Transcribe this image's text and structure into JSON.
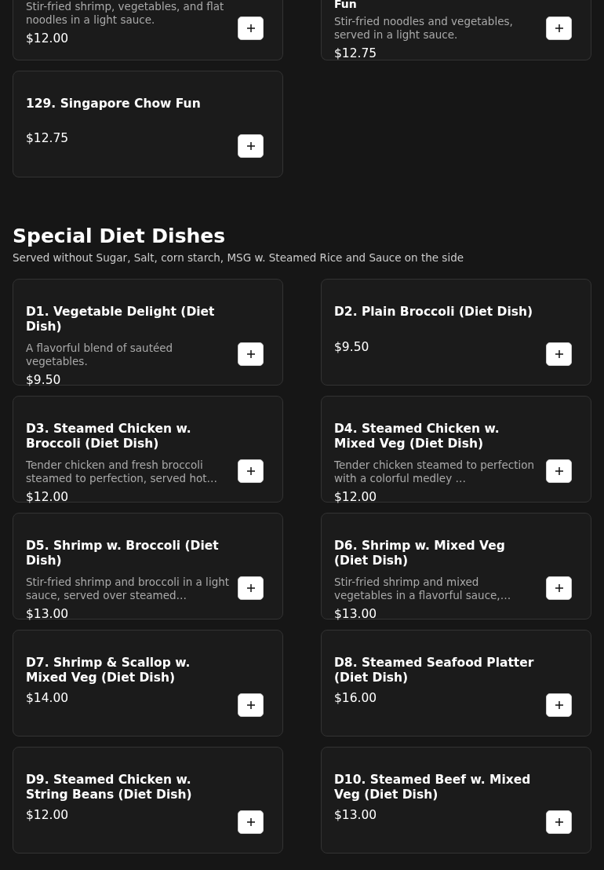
{
  "previous_items": [
    {
      "description": "Stir-fried shrimp, vegetables, and flat noodles in a light sauce.",
      "price": "$12.00"
    },
    {
      "title": "Fun",
      "description": "Stir-fried noodles and vegetables, served in a light sauce.",
      "price": "$12.75"
    },
    {
      "title": "129. Singapore Chow Fun",
      "price": "$12.75"
    }
  ],
  "section": {
    "title": "Special Diet Dishes",
    "subtitle": "Served without Sugar, Salt, corn starch, MSG w. Steamed Rice and Sauce on the side",
    "items": [
      {
        "title": "D1. Vegetable Delight (Diet Dish)",
        "description": "A flavorful blend of sautéed vegetables.",
        "price": "$9.50"
      },
      {
        "title": "D2. Plain Broccoli (Diet Dish)",
        "price": "$9.50"
      },
      {
        "title": "D3. Steamed Chicken w. Broccoli (Diet Dish)",
        "description": "Tender chicken and fresh broccoli steamed to perfection, served hot…",
        "price": "$12.00"
      },
      {
        "title": "D4. Steamed Chicken w. Mixed Veg (Diet Dish)",
        "description": "Tender chicken steamed to perfection with a colorful medley …",
        "price": "$12.00"
      },
      {
        "title": "D5. Shrimp w. Broccoli (Diet Dish)",
        "description": "Stir-fried shrimp and broccoli in a light sauce, served over steamed…",
        "price": "$13.00"
      },
      {
        "title": "D6. Shrimp w. Mixed Veg (Diet Dish)",
        "description": "Stir-fried shrimp and mixed vegetables in a flavorful sauce,…",
        "price": "$13.00"
      },
      {
        "title": "D7. Shrimp & Scallop w. Mixed Veg (Diet Dish)",
        "price": "$14.00"
      },
      {
        "title": "D8. Steamed Seafood Platter (Diet Dish)",
        "price": "$16.00"
      },
      {
        "title": "D9. Steamed Chicken w. String Beans (Diet Dish)",
        "price": "$12.00"
      },
      {
        "title": "D10. Steamed Beef w. Mixed Veg (Diet Dish)",
        "price": "$13.00"
      }
    ]
  }
}
